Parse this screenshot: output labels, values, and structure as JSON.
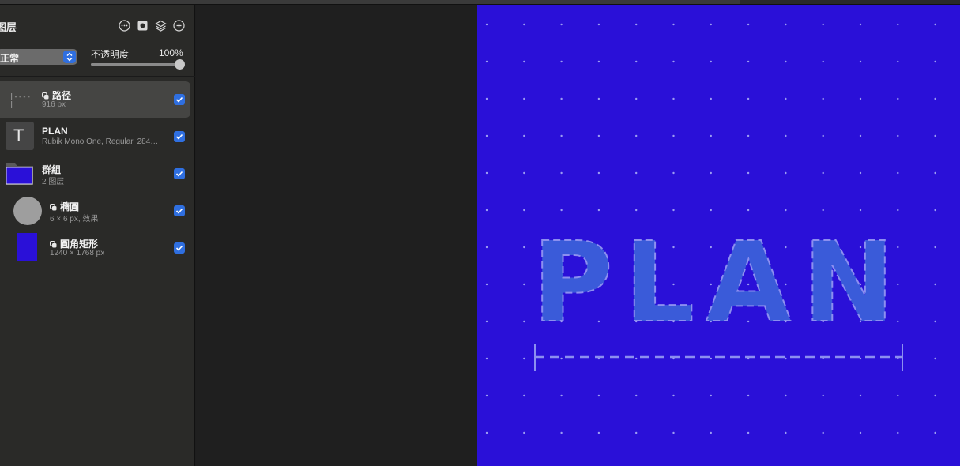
{
  "panel": {
    "title": "图层",
    "header_icons": [
      "more-icon",
      "mask-icon",
      "layers-icon",
      "add-icon"
    ],
    "blend_mode": "正常",
    "opacity_label": "不透明度",
    "opacity_value": "100%",
    "opacity_fraction": 1.0
  },
  "layers": [
    {
      "name": "路径",
      "sub": "916 px",
      "linked": true,
      "checked": true,
      "selected": true,
      "thumb_text": "|----|"
    },
    {
      "name": "PLAN",
      "sub": "Rubik Mono One, Regular, 284…",
      "linked": false,
      "checked": true,
      "selected": false,
      "thumb_text": "T"
    },
    {
      "name": "群組",
      "sub": "2 图层",
      "linked": false,
      "checked": true,
      "selected": false
    },
    {
      "name": "橢圓",
      "sub": "6 × 6 px, 效果",
      "linked": true,
      "checked": true,
      "selected": false
    },
    {
      "name": "圓角矩形",
      "sub": "1240 × 1768 px",
      "linked": true,
      "checked": true,
      "selected": false
    }
  ],
  "artboard": {
    "text": "PLAN",
    "background": "#2a10d8",
    "text_fill": "#3a5bd9",
    "dash_color": "#8c8ff0"
  },
  "colors": {
    "accent": "#2f6fe0",
    "panel_bg": "#2a2a28"
  }
}
